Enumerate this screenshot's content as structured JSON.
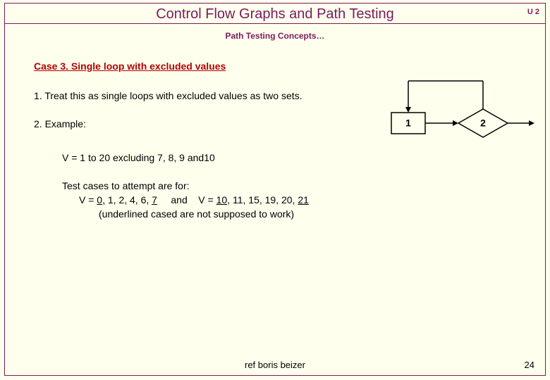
{
  "header": {
    "title": "Control Flow Graphs and Path Testing",
    "unit": "U 2"
  },
  "subtitle": "Path Testing Concepts…",
  "case_heading": "Case 3. Single loop with  excluded values",
  "body": {
    "item1": "1. Treat this as single loops with excluded values as two sets.",
    "item2": "2. Example:",
    "example_range": "V = 1 to 20  excluding 7, 8, 9 and10",
    "tests_intro": "Test cases to attempt are for:",
    "tests_vals_prefix": "V = ",
    "v0": "0,",
    "v_mid1": " 1, 2, 4, 6, ",
    "v7": "7",
    "and_label": "     and    V = ",
    "v10": "10,",
    "v_mid2": " 11, 15, 19, 20, ",
    "v21": "21",
    "tests_note": "(underlined cased are not supposed to work)"
  },
  "diagram": {
    "node1": "1",
    "node2": "2"
  },
  "footer": {
    "ref": "ref boris beizer",
    "page": "24"
  }
}
